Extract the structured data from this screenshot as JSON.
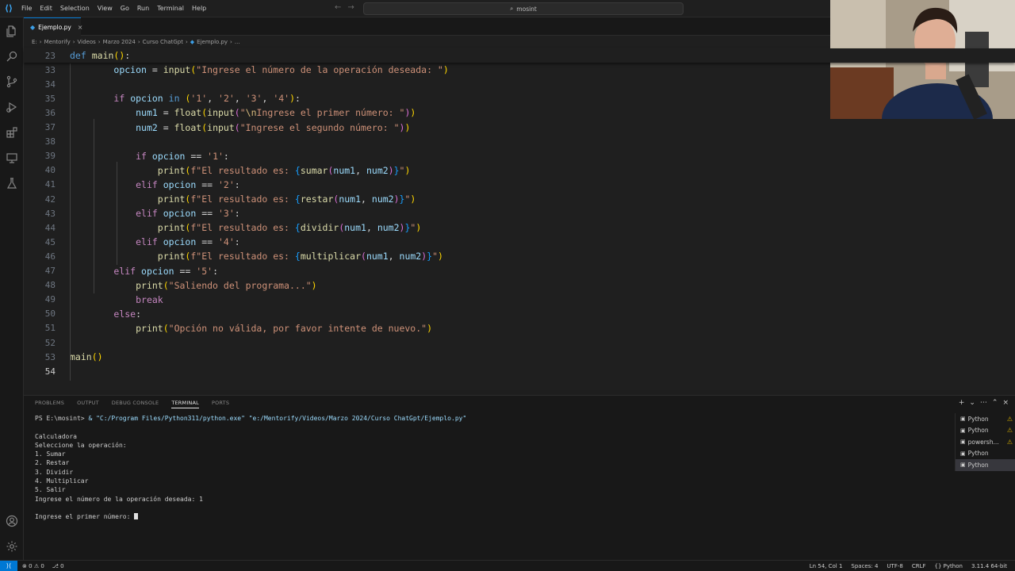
{
  "titlebar": {
    "menu": [
      "File",
      "Edit",
      "Selection",
      "View",
      "Go",
      "Run",
      "Terminal",
      "Help"
    ],
    "search_text": "mosint"
  },
  "tabs": [
    {
      "label": "Ejemplo.py"
    }
  ],
  "breadcrumb": [
    "E:",
    "Mentorify",
    "Videos",
    "Marzo 2024",
    "Curso ChatGpt",
    "Ejemplo.py",
    "..."
  ],
  "editor": {
    "lines": [
      {
        "n": "23",
        "text": "def main():"
      },
      {
        "n": "33",
        "text": "        opcion = input(\"Ingrese el número de la operación deseada: \")"
      },
      {
        "n": "34",
        "text": ""
      },
      {
        "n": "35",
        "text": "        if opcion in ('1', '2', '3', '4'):"
      },
      {
        "n": "36",
        "text": "            num1 = float(input(\"\\nIngrese el primer número: \"))"
      },
      {
        "n": "37",
        "text": "            num2 = float(input(\"Ingrese el segundo número: \"))"
      },
      {
        "n": "38",
        "text": ""
      },
      {
        "n": "39",
        "text": "            if opcion == '1':"
      },
      {
        "n": "40",
        "text": "                print(f\"El resultado es: {sumar(num1, num2)}\")"
      },
      {
        "n": "41",
        "text": "            elif opcion == '2':"
      },
      {
        "n": "42",
        "text": "                print(f\"El resultado es: {restar(num1, num2)}\")"
      },
      {
        "n": "43",
        "text": "            elif opcion == '3':"
      },
      {
        "n": "44",
        "text": "                print(f\"El resultado es: {dividir(num1, num2)}\")"
      },
      {
        "n": "45",
        "text": "            elif opcion == '4':"
      },
      {
        "n": "46",
        "text": "                print(f\"El resultado es: {multiplicar(num1, num2)}\")"
      },
      {
        "n": "47",
        "text": "        elif opcion == '5':"
      },
      {
        "n": "48",
        "text": "            print(\"Saliendo del programa...\")"
      },
      {
        "n": "49",
        "text": "            break"
      },
      {
        "n": "50",
        "text": "        else:"
      },
      {
        "n": "51",
        "text": "            print(\"Opción no válida, por favor intente de nuevo.\")"
      },
      {
        "n": "52",
        "text": ""
      },
      {
        "n": "53",
        "text": "main()"
      },
      {
        "n": "54",
        "text": ""
      }
    ]
  },
  "panel": {
    "tabs": [
      "PROBLEMS",
      "OUTPUT",
      "DEBUG CONSOLE",
      "TERMINAL",
      "PORTS"
    ],
    "active_tab": "TERMINAL",
    "terminal": {
      "prompt": "PS E:\\mosint> ",
      "command": "& \"C:/Program Files/Python311/python.exe\" \"e:/Mentorify/Videos/Marzo 2024/Curso ChatGpt/Ejemplo.py\"",
      "output": [
        "",
        "Calculadora",
        "Seleccione la operación:",
        "1. Sumar",
        "2. Restar",
        "3. Dividir",
        "4. Multiplicar",
        "5. Salir",
        "Ingrese el número de la operación deseada: 1",
        "",
        "Ingrese el primer número: "
      ]
    },
    "terminal_list": [
      {
        "label": "Python",
        "warning": true
      },
      {
        "label": "Python",
        "warning": true
      },
      {
        "label": "powersh...",
        "warning": true
      },
      {
        "label": "Python",
        "warning": false
      },
      {
        "label": "Python",
        "warning": false,
        "selected": true
      }
    ]
  },
  "statusbar": {
    "errors": "0",
    "warnings": "0",
    "ports": "0",
    "position": "Ln 54, Col 1",
    "spaces": "Spaces: 4",
    "encoding": "UTF-8",
    "eol": "CRLF",
    "language": "Python",
    "interpreter": "3.11.4 64-bit"
  },
  "colors": {
    "accent": "#0078d4",
    "editor_bg": "#1f1f1f",
    "keyword": "#569cd6",
    "control": "#c586c0",
    "function": "#dcdcaa",
    "string": "#ce9178"
  }
}
